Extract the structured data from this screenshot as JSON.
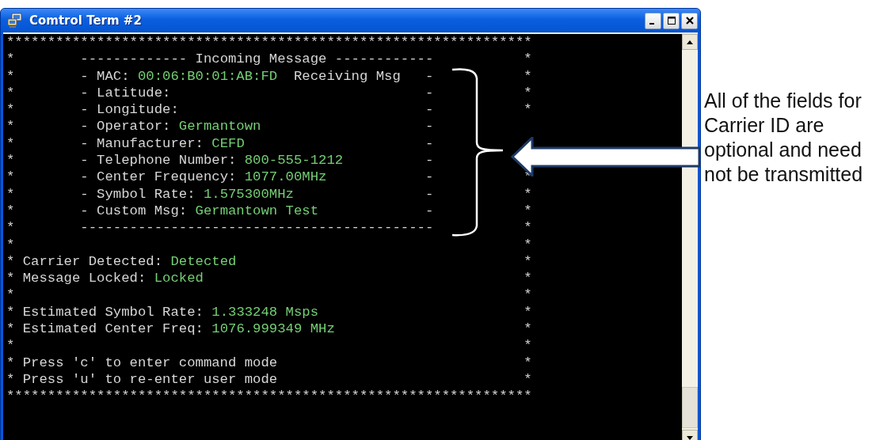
{
  "window": {
    "title": "Comtrol Term #2"
  },
  "terminal": {
    "lines": [
      {
        "kind": "border",
        "text": "****************************************************************"
      },
      {
        "kind": "box",
        "left": "*",
        "segments": [
          {
            "text": "------------- Incoming Message ------------",
            "kind": "label"
          }
        ],
        "right": "*"
      },
      {
        "kind": "box",
        "left": "*",
        "segments": [
          {
            "text": "- MAC: ",
            "kind": "label"
          },
          {
            "text": "00:06:B0:01:AB:FD",
            "kind": "value"
          },
          {
            "text": "  Receiving Msg",
            "kind": "label"
          }
        ],
        "dash": "-",
        "right": "*"
      },
      {
        "kind": "box",
        "left": "*",
        "segments": [
          {
            "text": "- Latitude:",
            "kind": "label"
          }
        ],
        "dash": "-",
        "right": "*"
      },
      {
        "kind": "box",
        "left": "*",
        "segments": [
          {
            "text": "- Longitude:",
            "kind": "label"
          }
        ],
        "dash": "-",
        "right": "*"
      },
      {
        "kind": "box",
        "left": "*",
        "segments": [
          {
            "text": "- Operator: ",
            "kind": "label"
          },
          {
            "text": "Germantown",
            "kind": "value"
          }
        ],
        "dash": "-"
      },
      {
        "kind": "box",
        "left": "*",
        "segments": [
          {
            "text": "- Manufacturer: ",
            "kind": "label"
          },
          {
            "text": "CEFD",
            "kind": "value"
          }
        ],
        "dash": "-"
      },
      {
        "kind": "box",
        "left": "*",
        "segments": [
          {
            "text": "- Telephone Number: ",
            "kind": "label"
          },
          {
            "text": "800-555-1212",
            "kind": "value"
          }
        ],
        "dash": "-"
      },
      {
        "kind": "box",
        "left": "*",
        "segments": [
          {
            "text": "- Center Frequency: ",
            "kind": "label"
          },
          {
            "text": "1077.00MHz",
            "kind": "value"
          }
        ],
        "dash": "-",
        "right": "*"
      },
      {
        "kind": "box",
        "left": "*",
        "segments": [
          {
            "text": "- Symbol Rate: ",
            "kind": "label"
          },
          {
            "text": "1.575300MHz",
            "kind": "value"
          }
        ],
        "dash": "-",
        "right": "*"
      },
      {
        "kind": "box",
        "left": "*",
        "segments": [
          {
            "text": "- Custom Msg: ",
            "kind": "label"
          },
          {
            "text": "Germantown Test",
            "kind": "value"
          }
        ],
        "dash": "-",
        "right": "*"
      },
      {
        "kind": "box",
        "left": "*",
        "segments": [
          {
            "text": "-------------------------------------------",
            "kind": "label"
          }
        ],
        "right": "*"
      },
      {
        "kind": "plain",
        "left": "*",
        "right": "*"
      },
      {
        "kind": "plain",
        "left": "*",
        "segments": [
          {
            "text": "Carrier Detected: ",
            "kind": "label"
          },
          {
            "text": "Detected",
            "kind": "value"
          }
        ],
        "right": "*"
      },
      {
        "kind": "plain",
        "left": "*",
        "segments": [
          {
            "text": "Message Locked: ",
            "kind": "label"
          },
          {
            "text": "Locked",
            "kind": "value"
          }
        ],
        "right": "*"
      },
      {
        "kind": "plain",
        "left": "*",
        "right": "*"
      },
      {
        "kind": "plain",
        "left": "*",
        "segments": [
          {
            "text": "Estimated Symbol Rate: ",
            "kind": "label"
          },
          {
            "text": "1.333248 Msps",
            "kind": "value"
          }
        ],
        "right": "*"
      },
      {
        "kind": "plain",
        "left": "*",
        "segments": [
          {
            "text": "Estimated Center Freq: ",
            "kind": "label"
          },
          {
            "text": "1076.999349 MHz",
            "kind": "value"
          }
        ],
        "right": "*"
      },
      {
        "kind": "plain",
        "left": "*",
        "right": "*"
      },
      {
        "kind": "plain",
        "left": "*",
        "segments": [
          {
            "text": "Press 'c' to enter command mode",
            "kind": "label"
          }
        ],
        "right": "*"
      },
      {
        "kind": "plain",
        "left": "*",
        "segments": [
          {
            "text": "Press 'u' to re-enter user mode",
            "kind": "label"
          }
        ],
        "right": "*"
      },
      {
        "kind": "border",
        "text": "****************************************************************"
      }
    ]
  },
  "annotation": {
    "text": "All of the fields for Carrier ID are optional and need not be transmitted"
  }
}
